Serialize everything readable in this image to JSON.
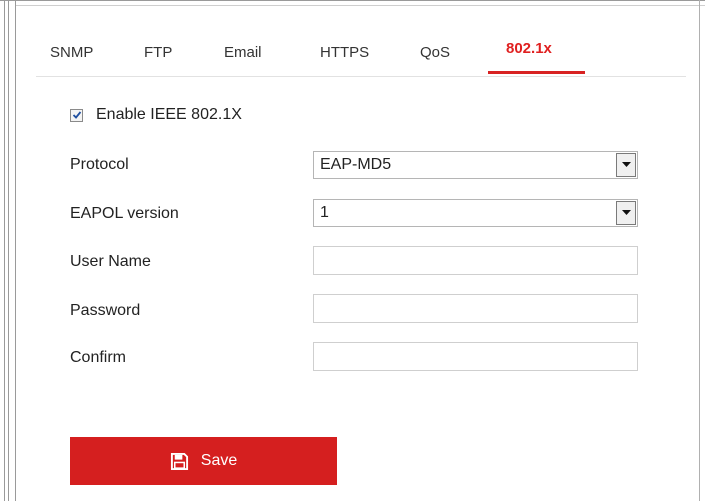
{
  "tabs": [
    {
      "label": "SNMP"
    },
    {
      "label": "FTP"
    },
    {
      "label": "Email"
    },
    {
      "label": "HTTPS"
    },
    {
      "label": "QoS"
    },
    {
      "label": "802.1x",
      "active": true
    }
  ],
  "form": {
    "enable_label": "Enable IEEE 802.1X",
    "enable_checked": true,
    "protocol_label": "Protocol",
    "protocol_value": "EAP-MD5",
    "eapol_label": "EAPOL version",
    "eapol_value": "1",
    "username_label": "User Name",
    "username_value": "",
    "password_label": "Password",
    "password_value": "",
    "confirm_label": "Confirm",
    "confirm_value": ""
  },
  "actions": {
    "save_label": "Save",
    "save_icon": "floppy-disk-icon"
  },
  "colors": {
    "accent": "#d51f1f",
    "active_tab_text": "#e02020"
  }
}
